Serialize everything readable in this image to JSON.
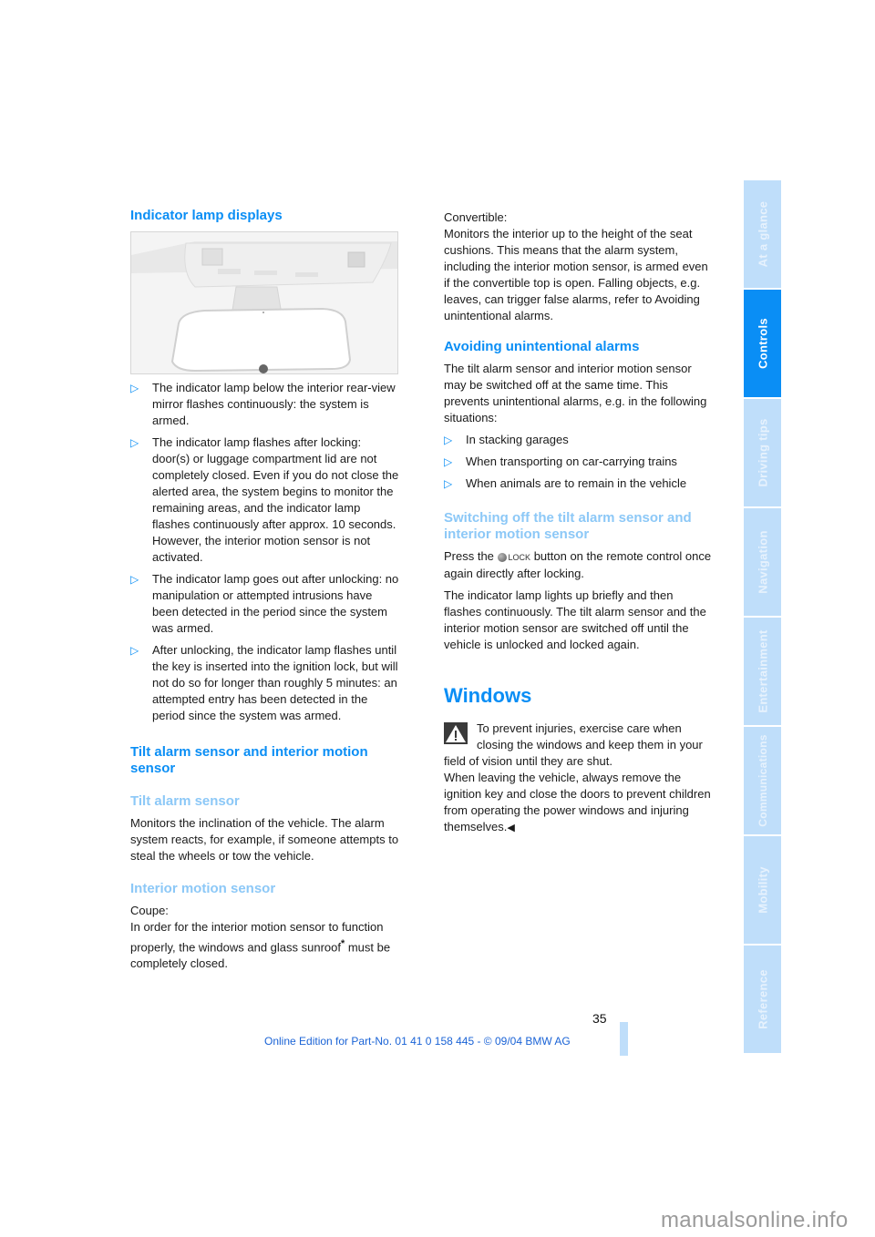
{
  "left_column": {
    "section1_title": "Indicator lamp displays",
    "image_alt": "Interior rear-view mirror with indicator lamp",
    "bullets": [
      "The indicator lamp below the interior rear-view mirror flashes continuously: the system is armed.",
      "The indicator lamp flashes after locking: door(s) or luggage compartment lid are not completely closed. Even if you do not close the alerted area, the system begins to monitor the remaining areas, and the indicator lamp flashes continuously after approx. 10 seconds. However, the interior motion sensor is not activated.",
      "The indicator lamp goes out after unlocking: no manipulation or attempted intrusions have been detected in the period since the system was armed.",
      "After unlocking, the indicator lamp flashes until the key is inserted into the ignition lock, but will not do so for longer than roughly 5 minutes: an attempted entry has been detected in the period since the system was armed."
    ],
    "section2_title": "Tilt alarm sensor and interior motion sensor",
    "sub1_title": "Tilt alarm sensor",
    "sub1_text": "Monitors the inclination of the vehicle. The alarm system reacts, for example, if someone attempts to steal the wheels or tow the vehicle.",
    "sub2_title": "Interior motion sensor",
    "coupe_label": "Coupe:",
    "coupe_text": "In order for the interior motion sensor to function properly, the windows and glass sunroof",
    "coupe_asterisk": "*",
    "coupe_text_end": "must be completely closed."
  },
  "right_column": {
    "convertible_label": "Convertible:",
    "convertible_text": "Monitors the interior up to the height of the seat cushions. This means that the alarm system, including the interior motion sensor, is armed even if the convertible top is open. Falling objects, e.g. leaves, can trigger false alarms, refer to Avoiding unintentional alarms.",
    "avoid_title": "Avoiding unintentional alarms",
    "avoid_text": "The tilt alarm sensor and interior motion sensor may be switched off at the same time. This prevents unintentional alarms, e.g. in the following situations:",
    "avoid_bullets": [
      "In stacking garages",
      "When transporting on car-carrying trains",
      "When animals are to remain in the vehicle"
    ],
    "switch_title": "Switching off the tilt alarm sensor and interior motion sensor",
    "press_prefix": "Press the",
    "lock_label": "LOCK",
    "press_suffix": "button on the remote control once again directly after locking.",
    "switch_text": "The indicator lamp lights up briefly and then flashes continuously. The tilt alarm sensor and the interior motion sensor are switched off until the vehicle is unlocked and locked again.",
    "windows_title": "Windows",
    "warning_text1": "To prevent injuries, exercise care when closing the windows and keep them in your field of vision until they are shut.",
    "warning_text2": "When leaving the vehicle, always remove the ignition key and close the doors to prevent children from operating the power windows and injuring themselves.",
    "end_mark": "◀"
  },
  "bullet_glyph": "▷",
  "sidebar": {
    "tabs": [
      {
        "label": "At a glance",
        "active": false
      },
      {
        "label": "Controls",
        "active": true
      },
      {
        "label": "Driving tips",
        "active": false
      },
      {
        "label": "Navigation",
        "active": false
      },
      {
        "label": "Entertainment",
        "active": false
      },
      {
        "label": "Communications",
        "active": false
      },
      {
        "label": "Mobility",
        "active": false
      },
      {
        "label": "Reference",
        "active": false
      }
    ]
  },
  "page_number": "35",
  "footer": "Online Edition for Part-No. 01 41 0 158 445 - © 09/04 BMW AG",
  "watermark": "manualsonline.info",
  "colors": {
    "heading_blue": "#0a8ef5",
    "subheading_blue": "#8cc8f7",
    "tab_inactive": "#bfdefa",
    "tab_active": "#0a8ef5",
    "footer_blue": "#1a63d6"
  }
}
